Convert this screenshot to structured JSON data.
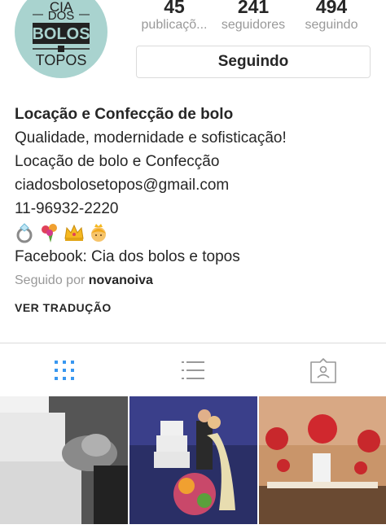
{
  "profile": {
    "avatar_lines": [
      "CIA",
      "DOS",
      "BOLOS",
      "TOPOS"
    ],
    "avatar_color": "#a9d3cf"
  },
  "stats": [
    {
      "value": "45",
      "label": "publicaçõ..."
    },
    {
      "value": "241",
      "label": "seguidores"
    },
    {
      "value": "494",
      "label": "seguindo"
    }
  ],
  "follow_button": {
    "label": "Seguindo"
  },
  "bio": {
    "name": "Locação e Confecção de bolo",
    "lines": [
      "Qualidade, modernidade e sofisticação!",
      "Locação de bolo e Confecção",
      "ciadosbolosetopos@gmail.com",
      "11-96932-2220"
    ],
    "emojis": [
      "ring-emoji",
      "bouquet-emoji",
      "crown-emoji",
      "princess-emoji"
    ],
    "facebook": "Facebook: Cia dos bolos e topos",
    "followed_by_prefix": "Seguido por",
    "followed_by_user": "novanoiva",
    "translate_label": "VER TRADUÇÃO"
  },
  "tabs": [
    {
      "icon": "grid-icon",
      "active": true
    },
    {
      "icon": "list-icon",
      "active": false
    },
    {
      "icon": "tagged-icon",
      "active": false
    }
  ],
  "colors": {
    "accent": "#3897f0",
    "inactive_icon": "#999999",
    "border": "#dbdbdb"
  }
}
